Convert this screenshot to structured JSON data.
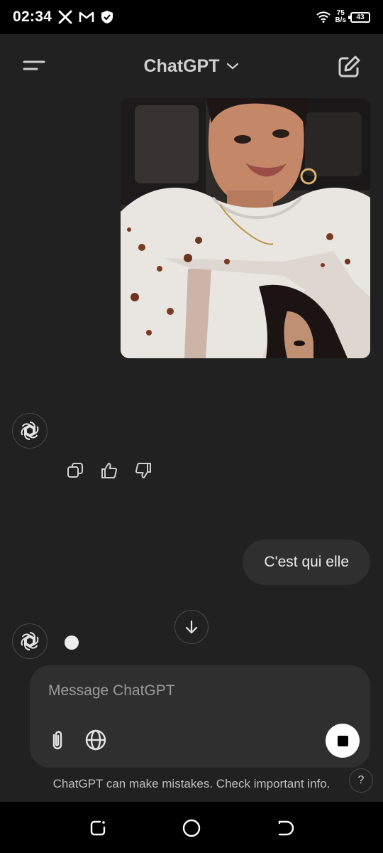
{
  "status_bar": {
    "time": "02:34",
    "net_speed_value": "75",
    "net_speed_unit": "B/s",
    "battery": "43",
    "icons": [
      "x-logo-icon",
      "gmail-icon",
      "shield-icon",
      "wifi-icon",
      "battery-icon"
    ]
  },
  "header": {
    "title": "ChatGPT",
    "icons": [
      "menu-icon",
      "chevron-down-icon",
      "new-chat-icon"
    ]
  },
  "conversation": {
    "image_alt": "User uploaded photo",
    "user_message": "C'est qui elle",
    "action_icons": [
      "copy-icon",
      "thumbs-up-icon",
      "thumbs-down-icon"
    ]
  },
  "composer": {
    "placeholder": "Message ChatGPT",
    "value": ""
  },
  "footer": {
    "disclaimer": "ChatGPT can make mistakes. Check important info.",
    "help_label": "?"
  },
  "colors": {
    "background": "#212121",
    "bubble": "#2f2f2f",
    "text": "#ececec"
  }
}
